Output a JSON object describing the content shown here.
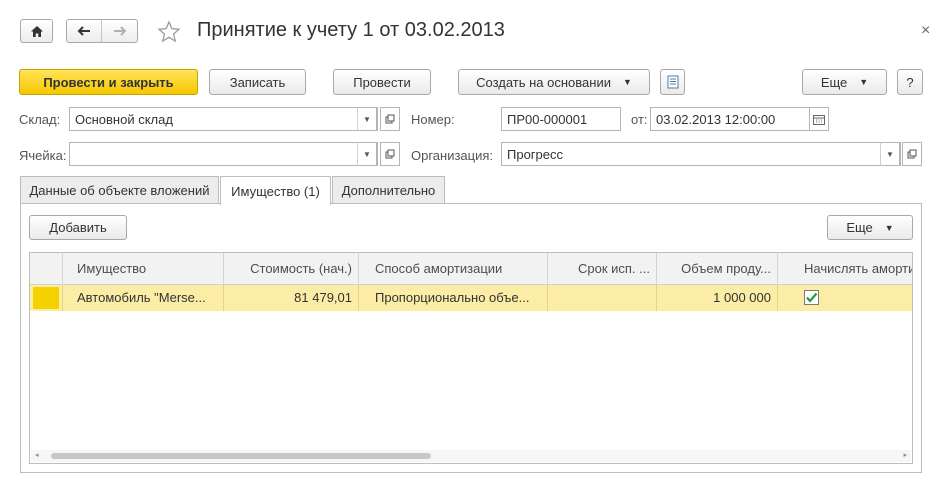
{
  "window": {
    "title": "Принятие к учету 1 от 03.02.2013",
    "close_glyph": "×"
  },
  "toolbar": {
    "post_close": "Провести и закрыть",
    "save": "Записать",
    "post": "Провести",
    "create_based": "Создать на основании",
    "more": "Еще",
    "help": "?"
  },
  "form": {
    "warehouse_label": "Склад:",
    "warehouse_value": "Основной склад",
    "cell_label": "Ячейка:",
    "cell_value": "",
    "number_label": "Номер:",
    "number_value": "ПР00-000001",
    "date_label": "от:",
    "date_value": "03.02.2013 12:00:00",
    "org_label": "Организация:",
    "org_value": "Прогресс"
  },
  "tabs": [
    {
      "label": "Данные об объекте вложений"
    },
    {
      "label": "Имущество (1)"
    },
    {
      "label": "Дополнительно"
    }
  ],
  "table_toolbar": {
    "add": "Добавить",
    "more": "Еще"
  },
  "table": {
    "columns": [
      "Имущество",
      "Стоимость (нач.)",
      "Способ амортизации",
      "Срок исп. ...",
      "Объем проду...",
      "Начислять аморти"
    ],
    "rows": [
      {
        "asset": "Автомобиль \"Merse...",
        "cost": "81 479,01",
        "method": "Пропорционально объе...",
        "term": "",
        "volume": "1 000 000",
        "accrue": true
      }
    ]
  }
}
